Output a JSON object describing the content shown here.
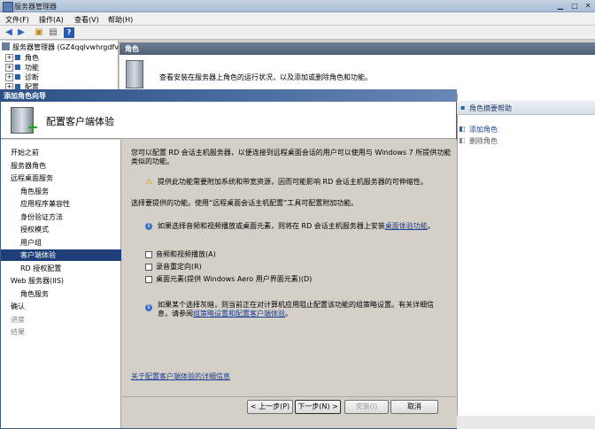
{
  "window": {
    "title": "服务器管理器"
  },
  "menu": {
    "items": [
      "文件(F)",
      "操作(A)",
      "查看(V)",
      "帮助(H)"
    ]
  },
  "tree": {
    "root": "服务器管理器 (GZ4qqlvwhrgdfv",
    "nodes": [
      "角色",
      "功能",
      "诊断",
      "配置"
    ]
  },
  "roles_panel": {
    "header": "角色",
    "description": "查看安装在服务器上角色的运行状况，以及添加或删除角色和功能。"
  },
  "help_panel": {
    "title": "角色摘要帮助",
    "add_role": "添加角色",
    "remove_role": "删除角色"
  },
  "dialog": {
    "title": "添加角色向导",
    "heading": "配置客户端体验",
    "nav": [
      {
        "label": "开始之前",
        "indent": 0,
        "state": "normal"
      },
      {
        "label": "服务器角色",
        "indent": 0,
        "state": "normal"
      },
      {
        "label": "远程桌面服务",
        "indent": 0,
        "state": "normal"
      },
      {
        "label": "角色服务",
        "indent": 1,
        "state": "normal"
      },
      {
        "label": "应用程序兼容性",
        "indent": 1,
        "state": "normal"
      },
      {
        "label": "身份验证方法",
        "indent": 1,
        "state": "normal"
      },
      {
        "label": "授权模式",
        "indent": 1,
        "state": "normal"
      },
      {
        "label": "用户组",
        "indent": 1,
        "state": "normal"
      },
      {
        "label": "客户端体验",
        "indent": 1,
        "state": "selected"
      },
      {
        "label": "RD 授权配置",
        "indent": 1,
        "state": "normal"
      },
      {
        "label": "Web 服务器(IIS)",
        "indent": 0,
        "state": "normal"
      },
      {
        "label": "角色服务",
        "indent": 1,
        "state": "normal"
      },
      {
        "label": "确认",
        "indent": 0,
        "state": "normal"
      },
      {
        "label": "进度",
        "indent": 0,
        "state": "disabled"
      },
      {
        "label": "结果",
        "indent": 0,
        "state": "disabled"
      }
    ],
    "intro_line1": "您可以配置 RD 会话主机服务器，以便连接到远程桌面会话的用户可以使用与 Windows 7 所提供功能",
    "intro_line2": "类似的功能。",
    "warning": "提供此功能需要附加系统和带宽资源，因而可能影响 RD 会话主机服务器的可伸缩性。",
    "select_prompt": "选择要提供的功能。使用“远程桌面会话主机配置”工具可配置附加功能。",
    "info1_text": "如果选择音频和视频播放或桌面元素，则将在 RD 会话主机服务器上安装",
    "info1_link": "桌面体验功能",
    "info1_end": "。",
    "options": [
      {
        "label": "音频和视频播放(A)",
        "checked": false
      },
      {
        "label": "录音重定向(R)",
        "checked": false
      },
      {
        "label": "桌面元素(提供 Windows Aero 用户界面元素)(D)",
        "checked": false
      }
    ],
    "info2_line1": "如果某个选择灰暗，则当前正在对计算机应用阻止配置该功能的组策略设置。有关详细信",
    "info2_line2_pre": "息，请参阅",
    "info2_link": "组策略设置和配置客户端体验",
    "info2_line2_end": "。",
    "more_info_link": "关于配置客户端体验的详细信息",
    "buttons": {
      "back": "< 上一步(P)",
      "next": "下一步(N) >",
      "install": "安装(I)",
      "cancel": "取消"
    }
  }
}
